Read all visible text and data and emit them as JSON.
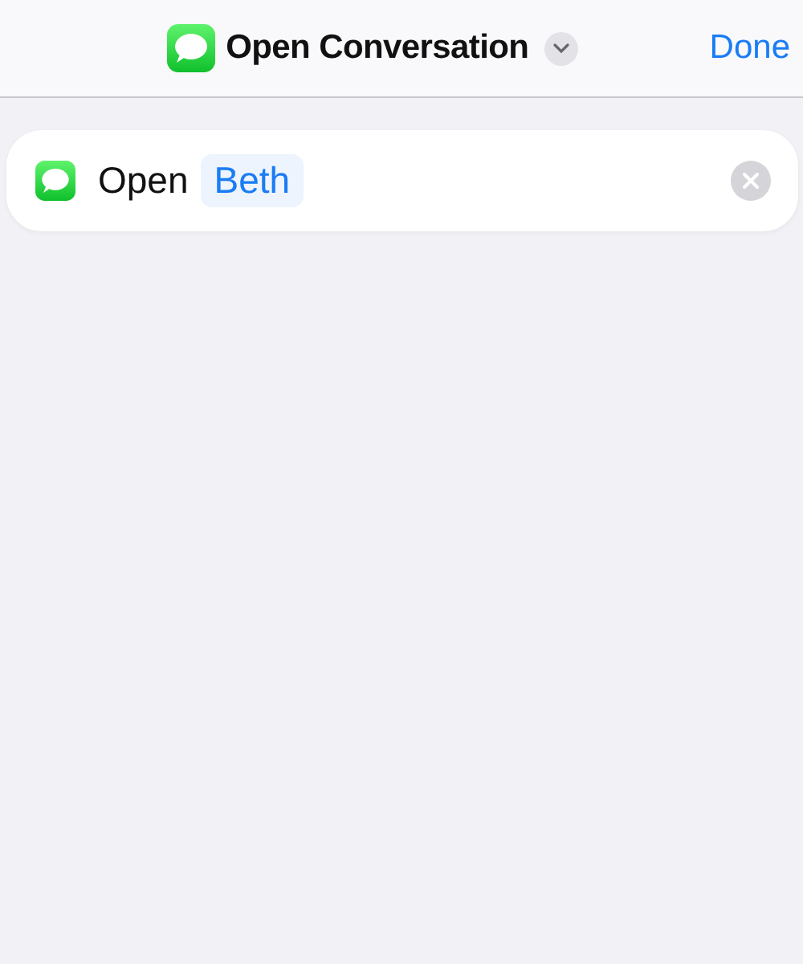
{
  "header": {
    "title": "Open Conversation",
    "done": "Done"
  },
  "action": {
    "verb": "Open",
    "parameter": "Beth"
  }
}
